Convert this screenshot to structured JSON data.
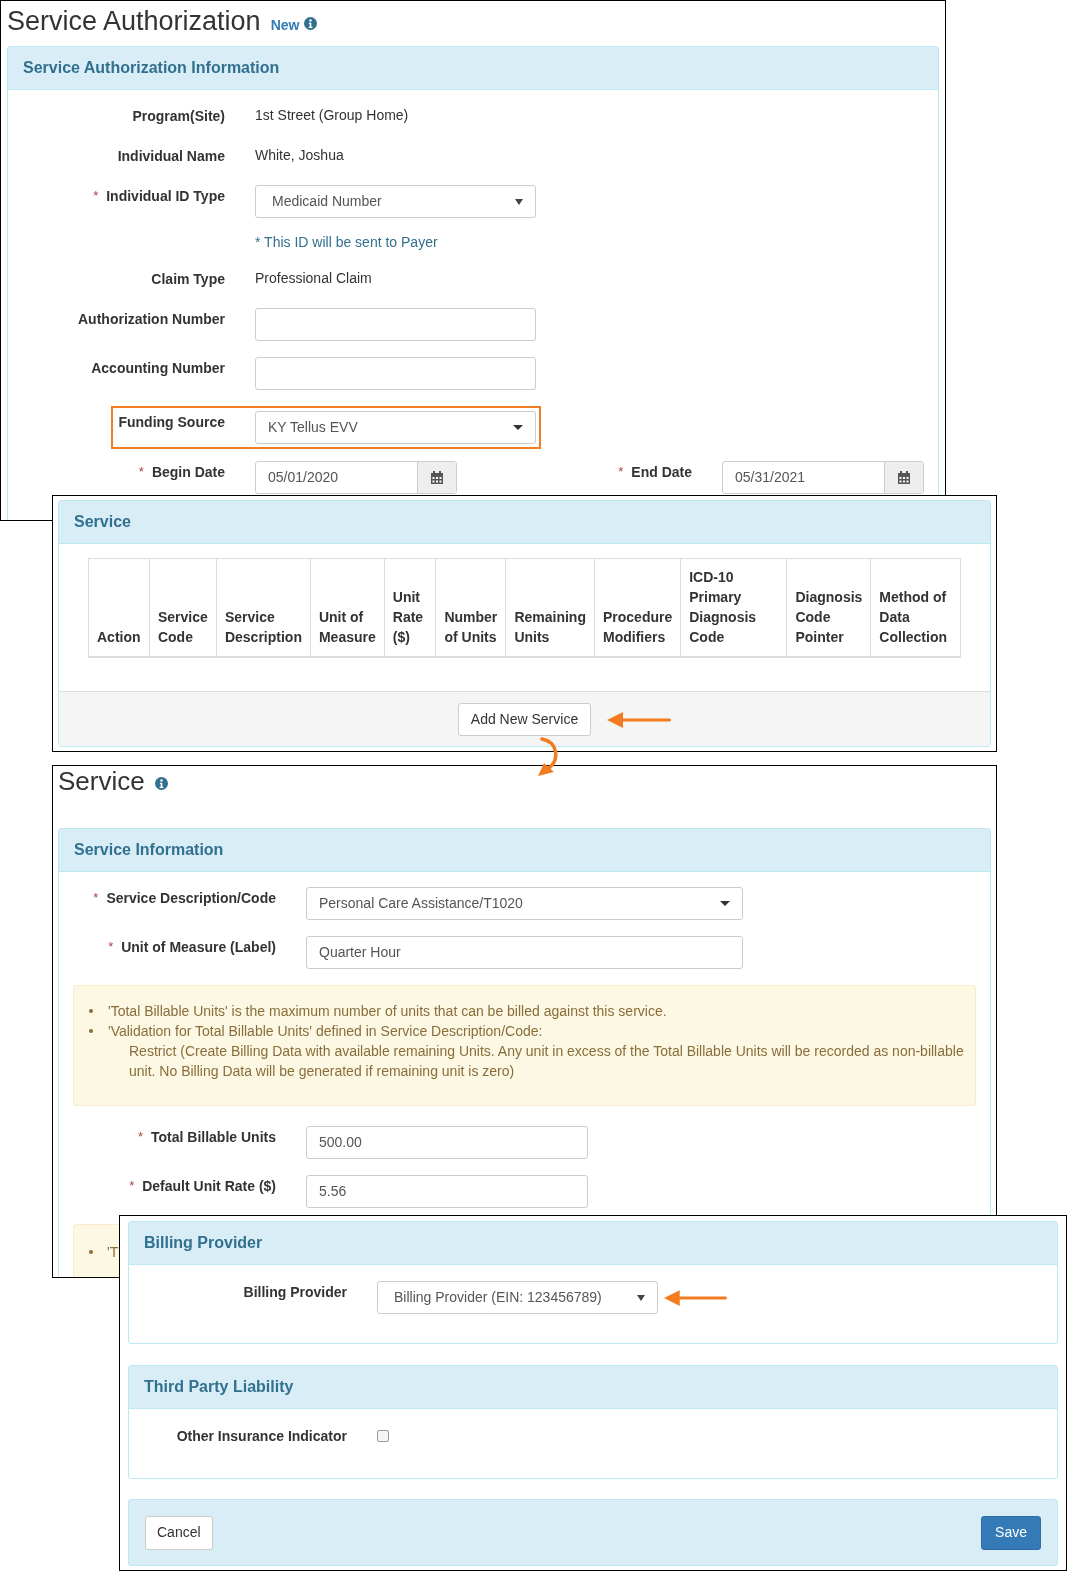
{
  "authorization": {
    "title": "Service Authorization",
    "badge": "New",
    "section": "Service Authorization Information",
    "fields": [
      {
        "kind": "text",
        "label": "Program(Site)",
        "value": "1st Street (Group Home)"
      },
      {
        "kind": "text",
        "label": "Individual Name",
        "value": "White, Joshua"
      },
      {
        "kind": "select",
        "marker": "*",
        "label": "Individual ID Type",
        "value": "Medicaid Number",
        "highlighted": false
      },
      {
        "kind": "note",
        "value": "* This ID will be sent to Payer"
      },
      {
        "kind": "text",
        "label": "Claim Type",
        "value": "Professional Claim"
      },
      {
        "kind": "input",
        "label": "Authorization Number"
      },
      {
        "kind": "input",
        "label": "Accounting Number"
      },
      {
        "kind": "dropdown",
        "label": "Funding Source",
        "value": "KY Tellus EVV",
        "highlighted": true
      }
    ],
    "begin_date": {
      "marker": "*",
      "label": "Begin Date",
      "value": "05/01/2020"
    },
    "end_date": {
      "marker": "*",
      "label": "End Date",
      "value": "05/31/2021"
    }
  },
  "service_list": {
    "section": "Service",
    "columns": [
      [
        "Action"
      ],
      [
        "Service",
        "Code"
      ],
      [
        "Service",
        "Description"
      ],
      [
        "Unit of",
        "Measure"
      ],
      [
        "Unit",
        "Rate",
        "($)"
      ],
      [
        "Number",
        "of Units"
      ],
      [
        "Remaining",
        "Units"
      ],
      [
        "Procedure",
        "Modifiers"
      ],
      [
        "ICD-10",
        "Primary",
        "Diagnosis",
        "Code"
      ],
      [
        "Diagnosis",
        "Code",
        "Pointer"
      ],
      [
        "Method of",
        "Data",
        "Collection"
      ]
    ],
    "button": "Add New Service"
  },
  "service": {
    "title": "Service",
    "section": "Service Information",
    "fields": [
      {
        "marker": "*",
        "label": "Service Description/Code",
        "kind": "dropdown",
        "value": "Personal Care Assistance/T1020"
      },
      {
        "marker": "*",
        "label": "Unit of Measure (Label)",
        "kind": "input",
        "value": "Quarter Hour"
      }
    ],
    "notes": [
      "'Total Billable Units' is the maximum number of units that can be billed against this service.",
      "'Validation for Total Billable Units' defined in Service Description/Code:"
    ],
    "note_detail": "Restrict (Create Billing Data with available remaining Units. Any unit in excess of the Total Billable Units will be recorded as non-billable unit. No Billing Data will be generated if remaining unit is zero)",
    "unit_fields": [
      {
        "marker": "*",
        "label": "Total Billable Units",
        "value": "500.00"
      },
      {
        "marker": "*",
        "label": "Default Unit Rate ($)",
        "value": "5.56"
      }
    ],
    "second_note": "'T"
  },
  "billing": {
    "section": "Billing Provider",
    "label": "Billing Provider",
    "value": "Billing Provider (EIN: 123456789)"
  },
  "third_party": {
    "section": "Third Party Liability",
    "label": "Other Insurance Indicator",
    "checked": false
  },
  "buttons": {
    "cancel": "Cancel",
    "save": "Save"
  }
}
